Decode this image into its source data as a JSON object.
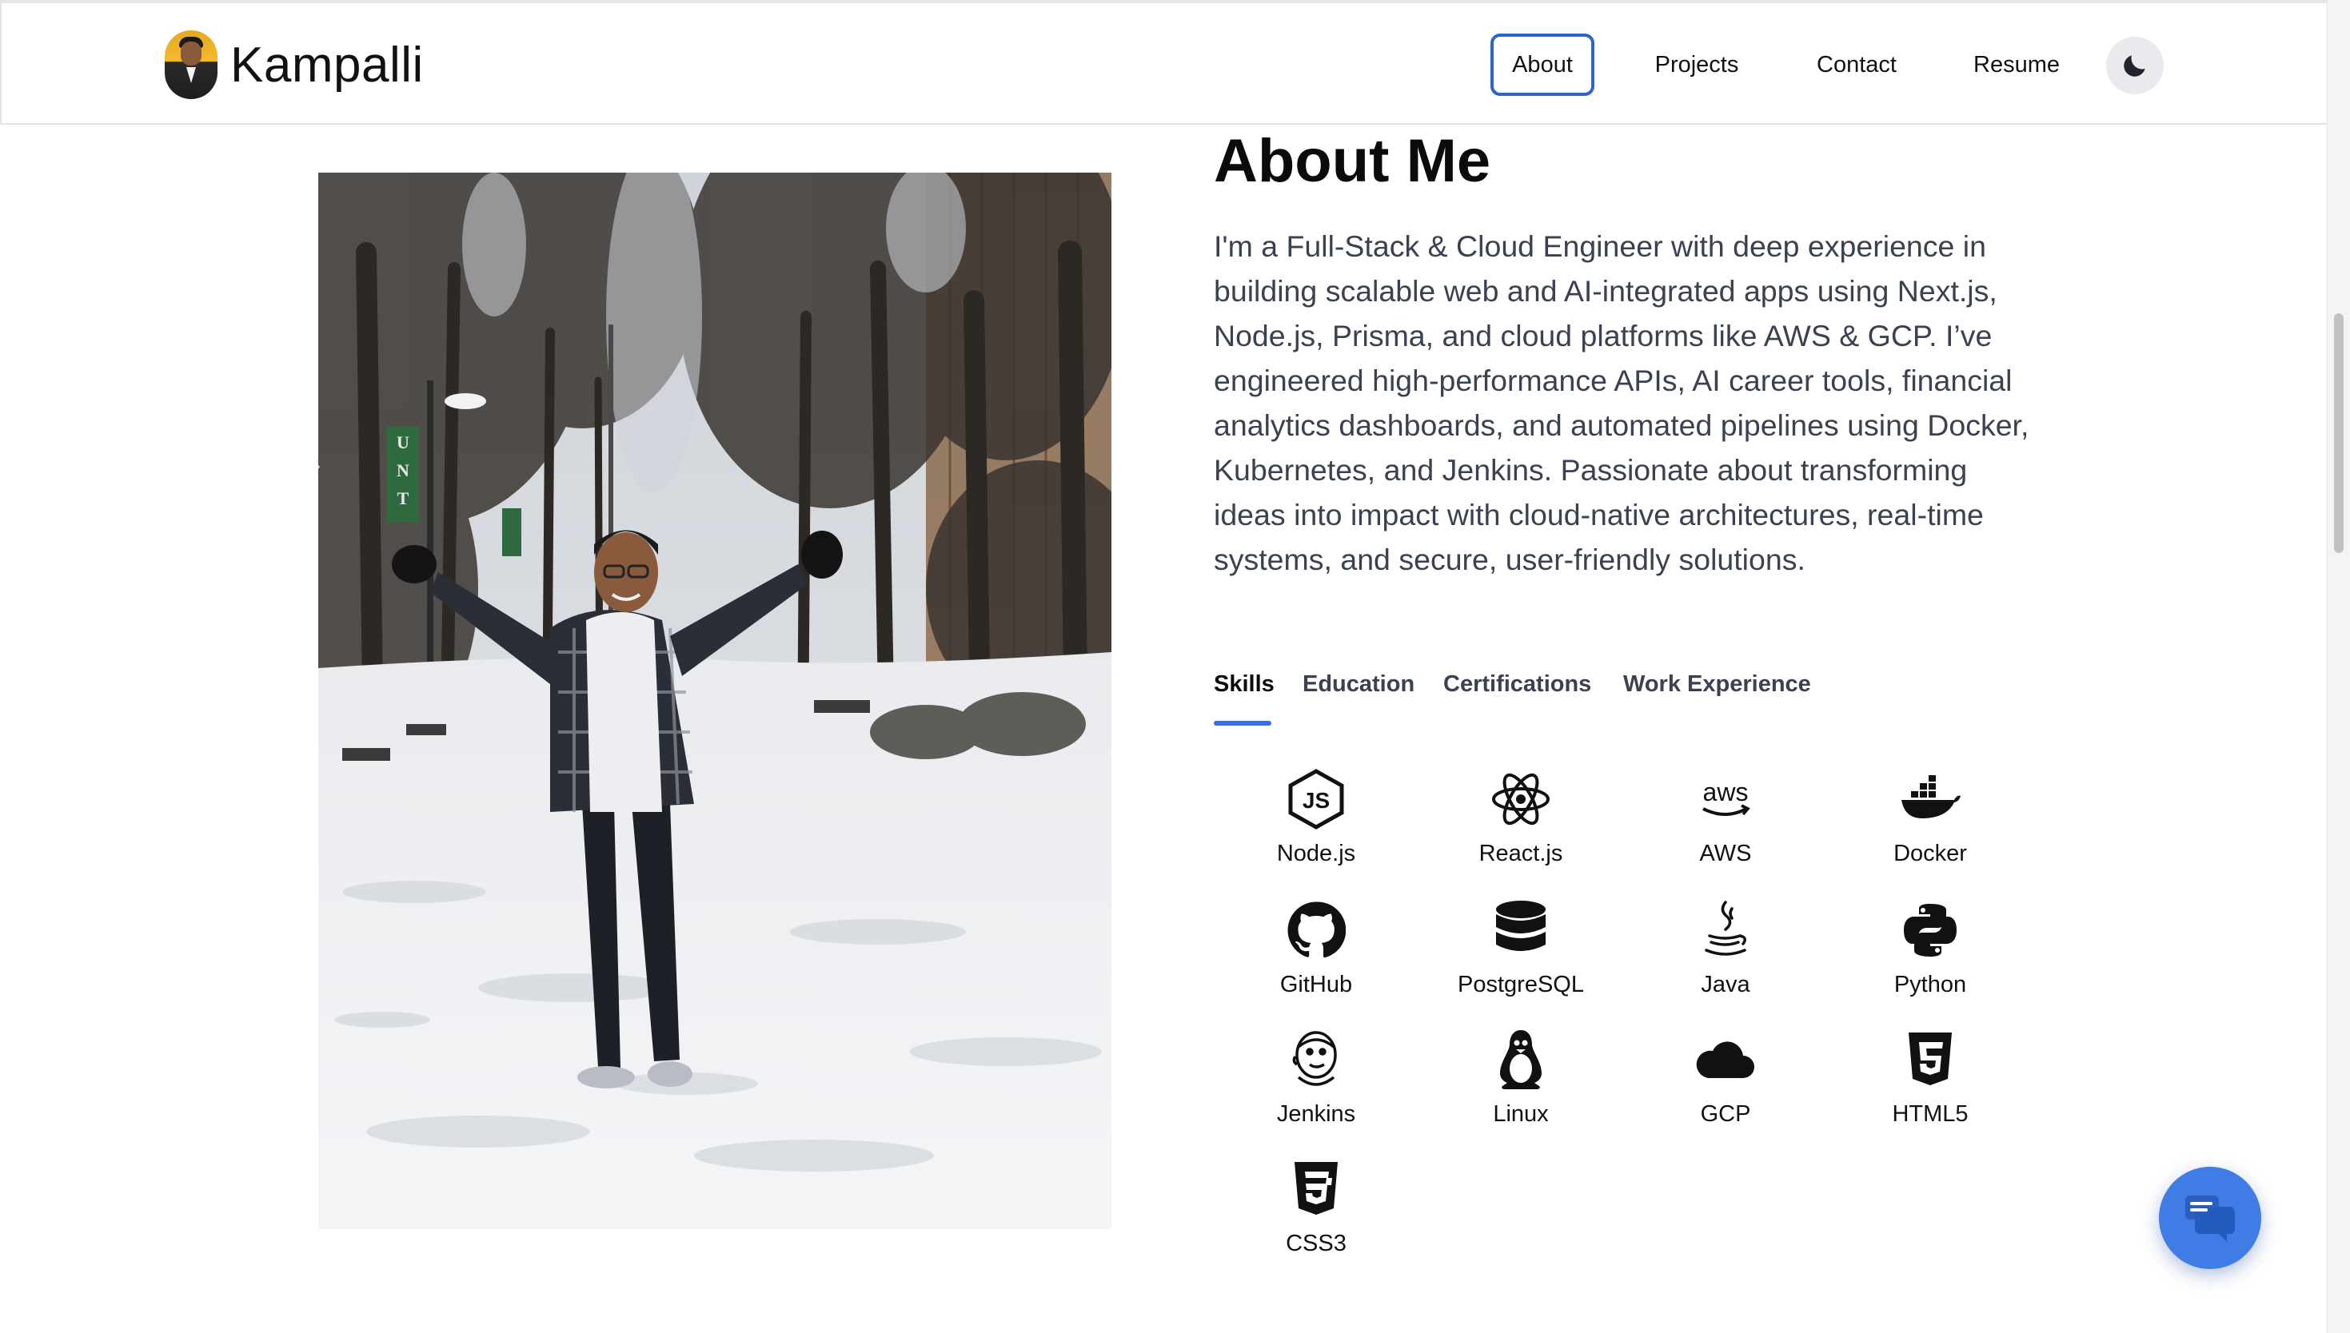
{
  "header": {
    "brand_name": "Kampalli",
    "nav": {
      "about": "About",
      "projects": "Projects",
      "contact": "Contact",
      "resume": "Resume"
    },
    "active_nav": "About",
    "theme_icon": "moon-icon"
  },
  "about": {
    "title": "About Me",
    "body": "I'm a Full-Stack & Cloud Engineer with deep experience in building scalable web and AI-integrated apps using Next.js, Node.js, Prisma, and cloud platforms like AWS & GCP. I’ve engineered high-performance APIs, AI career tools, financial analytics dashboards, and automated pipelines using Docker, Kubernetes, and Jenkins. Passionate about transforming ideas into impact with cloud-native architectures, real-time systems, and secure, user-friendly solutions."
  },
  "tabs": {
    "skills": "Skills",
    "education": "Education",
    "certifications": "Certifications",
    "work": "Work Experience",
    "active": "Skills"
  },
  "skills": [
    {
      "label": "Node.js",
      "icon": "nodejs-icon"
    },
    {
      "label": "React.js",
      "icon": "react-icon"
    },
    {
      "label": "AWS",
      "icon": "aws-icon"
    },
    {
      "label": "Docker",
      "icon": "docker-icon"
    },
    {
      "label": "GitHub",
      "icon": "github-icon"
    },
    {
      "label": "PostgreSQL",
      "icon": "database-icon"
    },
    {
      "label": "Java",
      "icon": "java-icon"
    },
    {
      "label": "Python",
      "icon": "python-icon"
    },
    {
      "label": "Jenkins",
      "icon": "jenkins-icon"
    },
    {
      "label": "Linux",
      "icon": "linux-icon"
    },
    {
      "label": "GCP",
      "icon": "cloud-icon"
    },
    {
      "label": "HTML5",
      "icon": "html5-icon"
    },
    {
      "label": "CSS3",
      "icon": "css3-icon"
    }
  ],
  "photo": {
    "signage": "UNT"
  },
  "colors": {
    "accent": "#3b6fd8",
    "chat_button": "#3f7ce6",
    "body_text": "#3a4150"
  },
  "chat_button_icon": "chat-icon"
}
